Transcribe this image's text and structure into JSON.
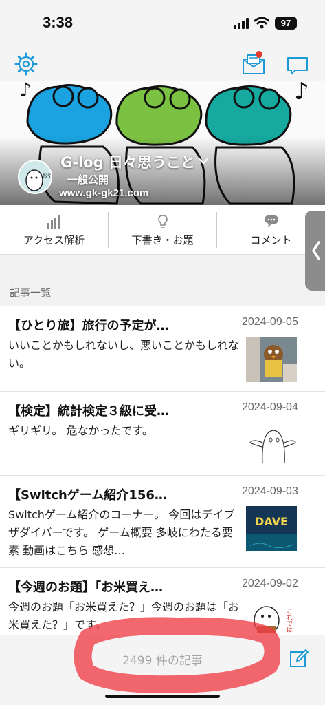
{
  "status_bar": {
    "time": "3:38",
    "battery": "97"
  },
  "top_nav": {
    "icons": [
      "gear-icon",
      "mail-icon",
      "chat-icon"
    ],
    "notification_color": "#e53b2e",
    "accent": "#1e9bd7"
  },
  "blog": {
    "title": "G-log 日々思うこと",
    "visibility": "一般公開",
    "url": "www.gk-gk21.com",
    "avatar_text": "おや-"
  },
  "tools": [
    {
      "label": "アクセス解析",
      "icon": "bar-chart-icon"
    },
    {
      "label": "下書き・お題",
      "icon": "lightbulb-icon"
    },
    {
      "label": "コメント",
      "icon": "speech-bubble-icon"
    }
  ],
  "section_label": "記事一覧",
  "articles": [
    {
      "title": "【ひとり旅】旅行の予定が…",
      "date": "2024-09-05",
      "excerpt": "いいことかもしれないし、悪いことかもしれない。"
    },
    {
      "title": "【検定】統計検定３級に受…",
      "date": "2024-09-04",
      "excerpt": "ギリギリ。 危なかったです。"
    },
    {
      "title": "【Switchゲーム紹介156…",
      "date": "2024-09-03",
      "excerpt": "Switchゲーム紹介のコーナー。 今回はデイブザダイバーです。 ゲーム概要 多岐にわたる要素 動画はこちら 感想…",
      "thumb_text": "DAVE"
    },
    {
      "title": "【今週のお題】「お米買え…",
      "date": "2024-09-02",
      "excerpt": "今週のお題「お米買えた？」今週のお題は「お米買えた？」です。",
      "thumb_text": "これでは聞いてくれた"
    }
  ],
  "bottom_bar": {
    "count": "2499 件の記事"
  }
}
